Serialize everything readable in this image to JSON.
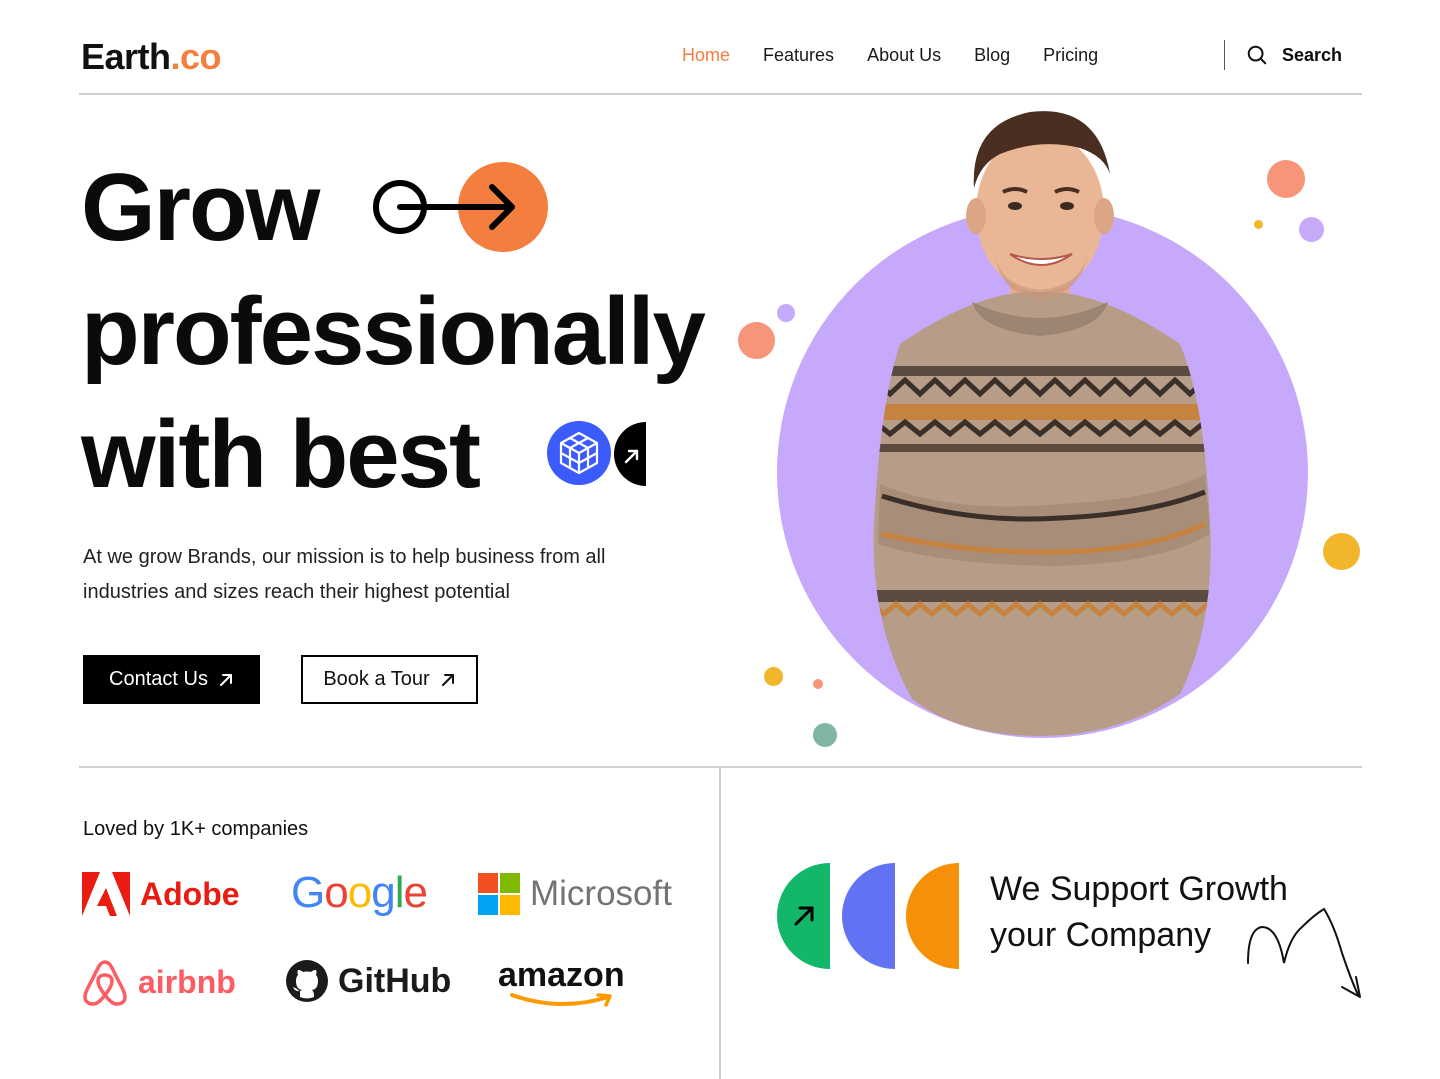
{
  "header": {
    "logo_main": "Earth",
    "logo_accent": ".co",
    "nav": [
      "Home",
      "Features",
      "About Us",
      "Blog",
      "Pricing"
    ],
    "search_label": "Search"
  },
  "hero": {
    "line1": "Grow",
    "line2": "professionally",
    "line3": "with best",
    "description": "At we grow Brands, our mission is to help business from all industries and sizes reach their highest potential",
    "primary_button": "Contact Us",
    "secondary_button": "Book a Tour"
  },
  "partners": {
    "heading": "Loved by 1K+ companies",
    "brands": [
      "Adobe",
      "Google",
      "Microsoft",
      "airbnb",
      "GitHub",
      "amazon"
    ]
  },
  "support": {
    "line1": "We Support Growth",
    "line2": "your Company"
  },
  "colors": {
    "accent": "#f47e3e",
    "purple": "#c6a9fb",
    "green": "#12b76a",
    "blue": "#6172f3",
    "orange": "#f79009"
  }
}
